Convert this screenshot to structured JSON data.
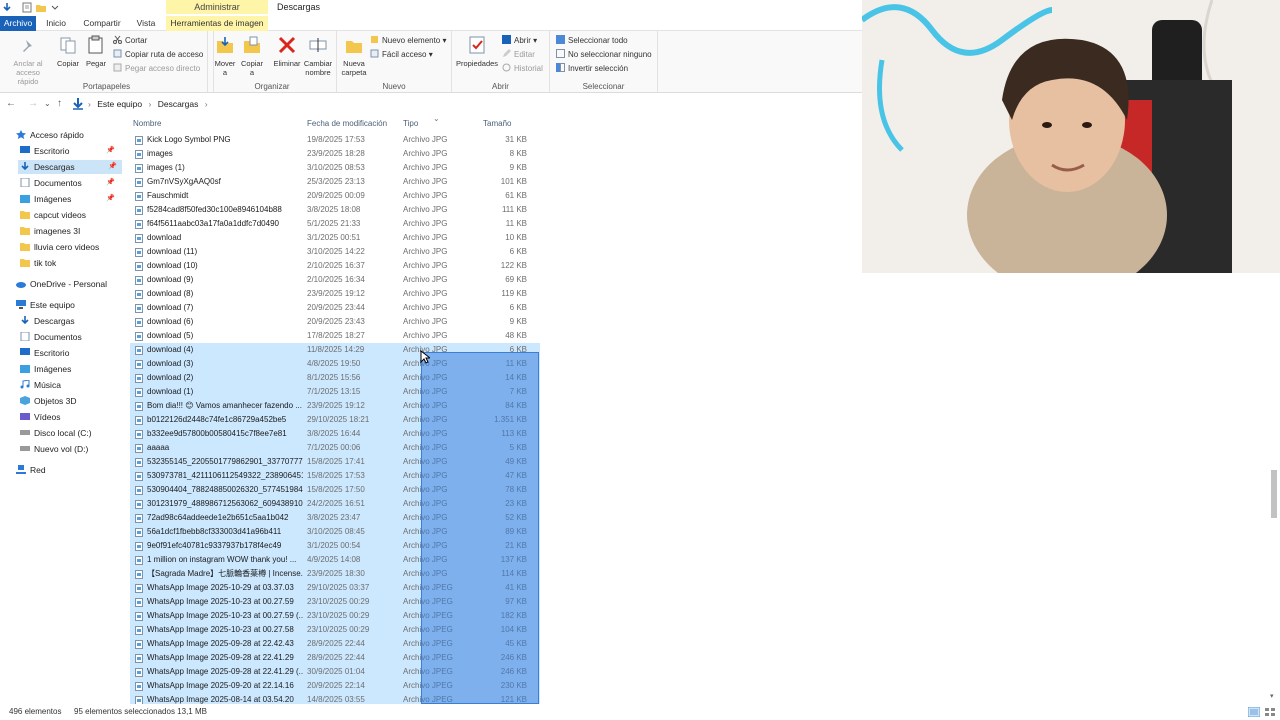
{
  "title_bar": {
    "contextual_tab": "Administrar",
    "window_title": "Descargas"
  },
  "tabs": [
    {
      "label": "Archivo"
    },
    {
      "label": "Inicio"
    },
    {
      "label": "Compartir"
    },
    {
      "label": "Vista"
    },
    {
      "label": "Herramientas de imagen"
    }
  ],
  "ribbon": {
    "portapapeles": {
      "group_label": "Portapapeles",
      "anclar": "Anclar al acceso rápido",
      "copiar": "Copiar",
      "pegar": "Pegar",
      "cortar": "Cortar",
      "copiar_ruta": "Copiar ruta de acceso",
      "pegar_acceso": "Pegar acceso directo"
    },
    "organizar": {
      "group_label": "Organizar",
      "mover": "Mover a",
      "copiar": "Copiar a",
      "eliminar": "Eliminar",
      "cambiar": "Cambiar nombre"
    },
    "nuevo": {
      "group_label": "Nuevo",
      "nueva_carpeta": "Nueva carpeta",
      "nuevo_elemento": "Nuevo elemento",
      "facil_acceso": "Fácil acceso"
    },
    "abrir": {
      "group_label": "Abrir",
      "propiedades": "Propiedades",
      "abrir": "Abrir",
      "editar": "Editar",
      "historial": "Historial"
    },
    "seleccionar": {
      "group_label": "Seleccionar",
      "todo": "Seleccionar todo",
      "ninguno": "No seleccionar ninguno",
      "invertir": "Invertir selección"
    }
  },
  "address": {
    "crumbs": [
      "Este equipo",
      "Descargas"
    ]
  },
  "sidebar": {
    "items": [
      {
        "label": "Acceso rápido"
      },
      {
        "label": "Escritorio"
      },
      {
        "label": "Descargas"
      },
      {
        "label": "Documentos"
      },
      {
        "label": "Imágenes"
      },
      {
        "label": "capcut videos"
      },
      {
        "label": "imagenes 3I"
      },
      {
        "label": "lluvia cero videos"
      },
      {
        "label": "tik tok"
      },
      {
        "label": "OneDrive - Personal"
      },
      {
        "label": "Este equipo"
      },
      {
        "label": "Descargas"
      },
      {
        "label": "Documentos"
      },
      {
        "label": "Escritorio"
      },
      {
        "label": "Imágenes"
      },
      {
        "label": "Música"
      },
      {
        "label": "Objetos 3D"
      },
      {
        "label": "Vídeos"
      },
      {
        "label": "Disco local (C:)"
      },
      {
        "label": "Nuevo vol (D:)"
      },
      {
        "label": "Red"
      }
    ]
  },
  "file_list": {
    "headers": {
      "name": "Nombre",
      "date": "Fecha de modificación",
      "type": "Tipo",
      "size": "Tamaño"
    },
    "rows": [
      {
        "name": "Kick Logo Symbol PNG",
        "date": "19/8/2025 17:53",
        "type": "Archivo JPG",
        "size": "31 KB",
        "selected": false
      },
      {
        "name": "images",
        "date": "23/9/2025 18:28",
        "type": "Archivo JPG",
        "size": "8 KB",
        "selected": false
      },
      {
        "name": "images (1)",
        "date": "3/10/2025 08:53",
        "type": "Archivo JPG",
        "size": "9 KB",
        "selected": false
      },
      {
        "name": "Gm7nVSyXgAAQ0sf",
        "date": "25/3/2025 23:13",
        "type": "Archivo JPG",
        "size": "101 KB",
        "selected": false
      },
      {
        "name": "Fauschmidt",
        "date": "20/9/2025 00:09",
        "type": "Archivo JPG",
        "size": "61 KB",
        "selected": false
      },
      {
        "name": "f5284cad8f50fed30c100e8946104b88",
        "date": "3/8/2025 18:08",
        "type": "Archivo JPG",
        "size": "111 KB",
        "selected": false
      },
      {
        "name": "f64f5611aabc03a17fa0a1ddfc7d0490",
        "date": "5/1/2025 21:33",
        "type": "Archivo JPG",
        "size": "11 KB",
        "selected": false
      },
      {
        "name": "download",
        "date": "3/1/2025 00:51",
        "type": "Archivo JPG",
        "size": "10 KB",
        "selected": false
      },
      {
        "name": "download (11)",
        "date": "3/10/2025 14:22",
        "type": "Archivo JPG",
        "size": "6 KB",
        "selected": false
      },
      {
        "name": "download (10)",
        "date": "2/10/2025 16:37",
        "type": "Archivo JPG",
        "size": "122 KB",
        "selected": false
      },
      {
        "name": "download (9)",
        "date": "2/10/2025 16:34",
        "type": "Archivo JPG",
        "size": "69 KB",
        "selected": false
      },
      {
        "name": "download (8)",
        "date": "23/9/2025 19:12",
        "type": "Archivo JPG",
        "size": "119 KB",
        "selected": false
      },
      {
        "name": "download (7)",
        "date": "20/9/2025 23:44",
        "type": "Archivo JPG",
        "size": "6 KB",
        "selected": false
      },
      {
        "name": "download (6)",
        "date": "20/9/2025 23:43",
        "type": "Archivo JPG",
        "size": "9 KB",
        "selected": false
      },
      {
        "name": "download (5)",
        "date": "17/8/2025 18:27",
        "type": "Archivo JPG",
        "size": "48 KB",
        "selected": false
      },
      {
        "name": "download (4)",
        "date": "11/8/2025 14:29",
        "type": "Archivo JPG",
        "size": "6 KB",
        "selected": true
      },
      {
        "name": "download (3)",
        "date": "4/8/2025 19:50",
        "type": "Archivo JPG",
        "size": "11 KB",
        "selected": true
      },
      {
        "name": "download (2)",
        "date": "8/1/2025 15:56",
        "type": "Archivo JPG",
        "size": "14 KB",
        "selected": true
      },
      {
        "name": "download (1)",
        "date": "7/1/2025 13:15",
        "type": "Archivo JPG",
        "size": "7 KB",
        "selected": true
      },
      {
        "name": "Bom dia!!! 😊 Vamos amanhecer fazendo ...",
        "date": "23/9/2025 19:12",
        "type": "Archivo JPG",
        "size": "84 KB",
        "selected": true
      },
      {
        "name": "b0122126d2448c74fe1c86729a452be5",
        "date": "29/10/2025 18:21",
        "type": "Archivo JPG",
        "size": "1.351 KB",
        "selected": true
      },
      {
        "name": "b332ee9d57800b00580415c7f8ee7e81",
        "date": "3/8/2025 16:44",
        "type": "Archivo JPG",
        "size": "113 KB",
        "selected": true
      },
      {
        "name": "aaaaa",
        "date": "7/1/2025 00:06",
        "type": "Archivo JPG",
        "size": "5 KB",
        "selected": true
      },
      {
        "name": "532355145_2205501779862901_337707770...",
        "date": "15/8/2025 17:41",
        "type": "Archivo JPG",
        "size": "49 KB",
        "selected": true
      },
      {
        "name": "530973781_4211106112549322_238906451...",
        "date": "15/8/2025 17:53",
        "type": "Archivo JPG",
        "size": "47 KB",
        "selected": true
      },
      {
        "name": "530904404_788248850026320_5774519843...",
        "date": "15/8/2025 17:50",
        "type": "Archivo JPG",
        "size": "78 KB",
        "selected": true
      },
      {
        "name": "301231979_488986712563062_6094389107...",
        "date": "24/2/2025 16:51",
        "type": "Archivo JPG",
        "size": "23 KB",
        "selected": true
      },
      {
        "name": "72ad98c64addeede1e2b651c5aa1b042",
        "date": "3/8/2025 23:47",
        "type": "Archivo JPG",
        "size": "52 KB",
        "selected": true
      },
      {
        "name": "56a1dcf1fbebb8cf333003d41a96b411",
        "date": "3/10/2025 08:45",
        "type": "Archivo JPG",
        "size": "89 KB",
        "selected": true
      },
      {
        "name": "9e0f91efc40781c9337937b178f4ec49",
        "date": "3/1/2025 00:54",
        "type": "Archivo JPG",
        "size": "21 KB",
        "selected": true
      },
      {
        "name": "1 million on instagram WOW thank you! ...",
        "date": "4/9/2025 14:08",
        "type": "Archivo JPG",
        "size": "137 KB",
        "selected": true
      },
      {
        "name": "【Sagrada Madre】七脈輪香薬樽 | Incense...",
        "date": "23/9/2025 18:30",
        "type": "Archivo JPG",
        "size": "114 KB",
        "selected": true
      },
      {
        "name": "WhatsApp Image 2025-10-29 at 03.37.03",
        "date": "29/10/2025 03:37",
        "type": "Archivo JPEG",
        "size": "41 KB",
        "selected": true
      },
      {
        "name": "WhatsApp Image 2025-10-23 at 00.27.59",
        "date": "23/10/2025 00:29",
        "type": "Archivo JPEG",
        "size": "97 KB",
        "selected": true
      },
      {
        "name": "WhatsApp Image 2025-10-23 at 00.27.59 (...",
        "date": "23/10/2025 00:29",
        "type": "Archivo JPEG",
        "size": "182 KB",
        "selected": true
      },
      {
        "name": "WhatsApp Image 2025-10-23 at 00.27.58",
        "date": "23/10/2025 00:29",
        "type": "Archivo JPEG",
        "size": "104 KB",
        "selected": true
      },
      {
        "name": "WhatsApp Image 2025-09-28 at 22.42.43",
        "date": "28/9/2025 22:44",
        "type": "Archivo JPEG",
        "size": "45 KB",
        "selected": true
      },
      {
        "name": "WhatsApp Image 2025-09-28 at 22.41.29",
        "date": "28/9/2025 22:44",
        "type": "Archivo JPEG",
        "size": "246 KB",
        "selected": true
      },
      {
        "name": "WhatsApp Image 2025-09-28 at 22.41.29 (...",
        "date": "30/9/2025 01:04",
        "type": "Archivo JPEG",
        "size": "246 KB",
        "selected": true
      },
      {
        "name": "WhatsApp Image 2025-09-20 at 22.14.16",
        "date": "20/9/2025 22:14",
        "type": "Archivo JPEG",
        "size": "230 KB",
        "selected": true
      },
      {
        "name": "WhatsApp Image 2025-08-14 at 03.54.20",
        "date": "14/8/2025 03:55",
        "type": "Archivo JPEG",
        "size": "121 KB",
        "selected": true
      }
    ]
  },
  "status": {
    "count": "496 elementos",
    "selected": "95 elementos seleccionados  13,1 MB"
  },
  "colors": {
    "accent": "#1a62b8",
    "selection": "#cce8ff",
    "drag_rect": "#3a7fd5",
    "context_tab": "#fff5a8"
  },
  "icons": [
    "back-icon",
    "forward-icon",
    "up-icon",
    "folder-icon",
    "image-file-icon",
    "pin-icon",
    "onedrive-icon",
    "pc-icon",
    "drive-icon",
    "network-icon"
  ]
}
